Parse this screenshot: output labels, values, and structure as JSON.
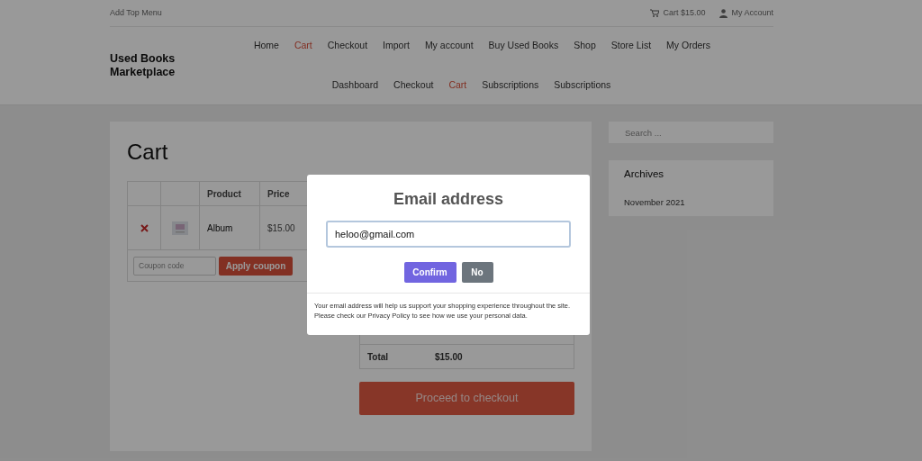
{
  "top_bar": {
    "menu_label": "Add Top Menu",
    "cart": "Cart $15.00",
    "account": "My Account"
  },
  "site_title": "Used Books Marketplace",
  "nav_rows": [
    [
      {
        "label": "Home",
        "selected": false
      },
      {
        "label": "Cart",
        "selected": true
      },
      {
        "label": "Checkout",
        "selected": false
      },
      {
        "label": "Import",
        "selected": false
      },
      {
        "label": "My account",
        "selected": false
      },
      {
        "label": "Buy Used Books",
        "selected": false
      },
      {
        "label": "Shop",
        "selected": false
      },
      {
        "label": "Store List",
        "selected": false
      },
      {
        "label": "My Orders",
        "selected": false
      }
    ],
    [
      {
        "label": "Dashboard",
        "selected": false
      },
      {
        "label": "Checkout",
        "selected": false
      },
      {
        "label": "Cart",
        "selected": true
      },
      {
        "label": "Subscriptions",
        "selected": false
      },
      {
        "label": "Subscriptions",
        "selected": false
      }
    ]
  ],
  "page_title": "Cart",
  "cart_table": {
    "columns": [
      "Product",
      "Price"
    ],
    "rows": [
      {
        "product": "Album",
        "price": "$15.00"
      }
    ]
  },
  "coupon": {
    "placeholder": "Coupon code",
    "button": "Apply coupon"
  },
  "totals": {
    "label": "Total",
    "value": "$15.00"
  },
  "checkout_button": "Proceed to checkout",
  "sidebar": {
    "search_placeholder": "Search ...",
    "archives_title": "Archives",
    "archives": [
      "November 2021"
    ]
  },
  "modal": {
    "title": "Email address",
    "email_value": "heloo@gmail.com",
    "confirm": "Confirm",
    "cancel": "No",
    "note": "Your email address will help us support your shopping experience throughout the site. Please check our Privacy Policy to see how we use your personal data."
  }
}
